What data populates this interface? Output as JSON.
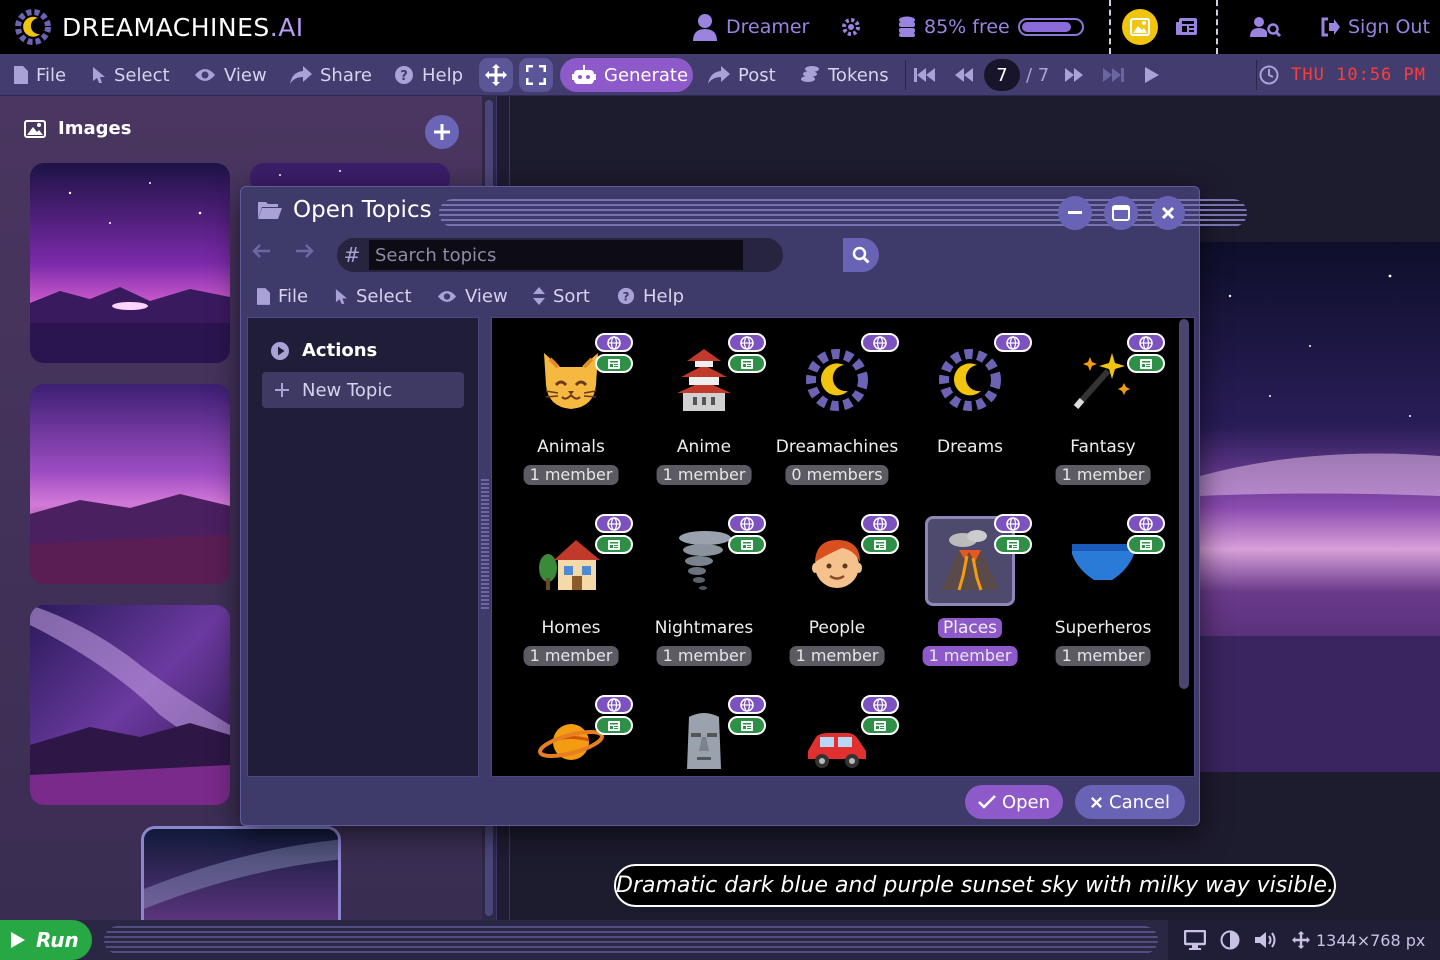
{
  "brand": {
    "name": "DREAMACHINES",
    "suffix": ".AI"
  },
  "topbar": {
    "user": "Dreamer",
    "memory": {
      "label": "85% free",
      "fraction": 0.85
    },
    "sign_out": "Sign Out"
  },
  "menubar": {
    "file": "File",
    "select": "Select",
    "view": "View",
    "share": "Share",
    "help": "Help",
    "generate": "Generate",
    "post": "Post",
    "tokens": "Tokens",
    "page_current": "7",
    "page_total": "/ 7"
  },
  "clock": "THU 10:56 PM",
  "images_panel": {
    "title": "Images"
  },
  "caption": "Dramatic dark blue and purple sunset sky with milky way visible.",
  "bottombar": {
    "run": "Run",
    "size": "1344×768 px"
  },
  "dialog": {
    "title": "Open Topics",
    "search_placeholder": "Search topics",
    "menu": {
      "file": "File",
      "select": "Select",
      "view": "View",
      "sort": "Sort",
      "help": "Help"
    },
    "sidebar": {
      "heading": "Actions",
      "items": [
        "New Topic"
      ]
    },
    "topics": [
      {
        "name": "Animals",
        "members": "1 member",
        "icon": "cat-face-icon"
      },
      {
        "name": "Anime",
        "members": "1 member",
        "icon": "japanese-castle-icon"
      },
      {
        "name": "Dreamachines",
        "members": "0 members",
        "icon": "dreamachines-logo-icon"
      },
      {
        "name": "Dreams",
        "members": "",
        "icon": "dreamachines-logo-icon"
      },
      {
        "name": "Fantasy",
        "members": "1 member",
        "icon": "magic-wand-icon"
      },
      {
        "name": "Homes",
        "members": "1 member",
        "icon": "house-icon"
      },
      {
        "name": "Nightmares",
        "members": "1 member",
        "icon": "tornado-icon"
      },
      {
        "name": "People",
        "members": "1 member",
        "icon": "person-face-icon"
      },
      {
        "name": "Places",
        "members": "1 member",
        "icon": "volcano-icon",
        "selected": true
      },
      {
        "name": "Superheros",
        "members": "1 member",
        "icon": "briefs-icon"
      },
      {
        "name": "",
        "members": "",
        "icon": "ringed-planet-icon"
      },
      {
        "name": "",
        "members": "",
        "icon": "moai-icon"
      },
      {
        "name": "",
        "members": "",
        "icon": "car-icon"
      }
    ],
    "buttons": {
      "open": "Open",
      "cancel": "Cancel"
    }
  },
  "colors": {
    "accent": "#8e5ac9",
    "clock": "#ff3b3b",
    "run": "#28a745"
  }
}
